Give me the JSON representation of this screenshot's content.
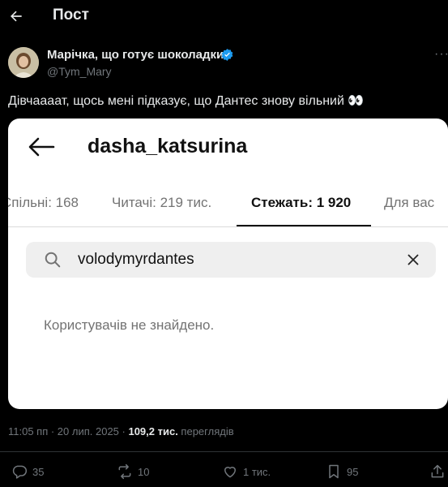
{
  "header": {
    "back_icon": "arrow-left-icon",
    "title": "Пост"
  },
  "author": {
    "name": "Марічка, що готує шоколадки",
    "handle": "@Tym_Mary",
    "verified_color": "#1d9bf0",
    "more": "···"
  },
  "tweet": {
    "text": "Дівчаааат, щось мені підказує, що Дантес знову вільний 👀"
  },
  "embedded": {
    "username": "dasha_katsurina",
    "tabs": [
      {
        "label": "Спільні: 168"
      },
      {
        "label": "Читачі: 219 тис."
      },
      {
        "label": "Стежать: 1 920"
      },
      {
        "label": "Для вас"
      }
    ],
    "active_tab": 2,
    "search": {
      "value": "volodymyrdantes"
    },
    "no_results": "Користувачів не знайдено."
  },
  "meta": {
    "time_date": "11:05 пп · 20 лип. 2025 · ",
    "views": "109,2 тис.",
    "views_label": " переглядів"
  },
  "actions": {
    "replies": "35",
    "reposts": "10",
    "likes": "1 тис.",
    "bookmarks": "95"
  },
  "colors": {
    "background": "#000000",
    "text": "#e7e9ea",
    "muted": "#71767b",
    "accent": "#1d9bf0"
  }
}
